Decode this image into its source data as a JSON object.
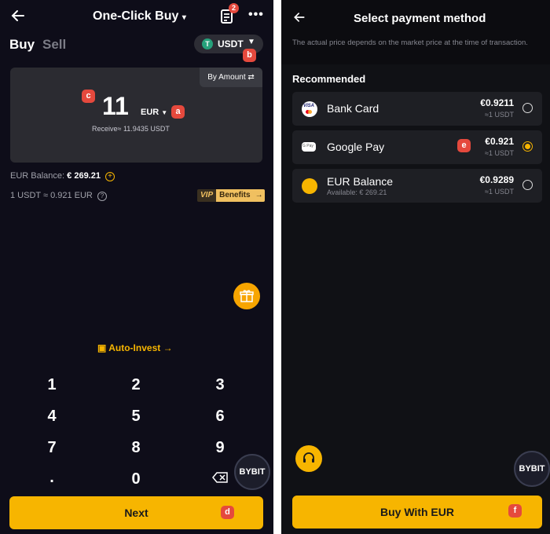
{
  "left": {
    "header": {
      "title": "One-Click Buy",
      "notif_count": "2"
    },
    "tabs": {
      "buy": "Buy",
      "sell": "Sell"
    },
    "coin": {
      "label": "USDT",
      "icon_glyph": "T"
    },
    "amount_card": {
      "by_amount": "By Amount",
      "amount": "11",
      "currency": "EUR",
      "receive": "Receive≈ 11.9435 USDT"
    },
    "balance": {
      "label": "EUR Balance:",
      "value": "€ 269.21"
    },
    "rate": {
      "text": "1 USDT ≈ 0.921 EUR"
    },
    "vip": {
      "tag": "VIP",
      "label": "Benefits"
    },
    "auto_invest": "Auto-Invest",
    "keypad": [
      "1",
      "2",
      "3",
      "4",
      "5",
      "6",
      "7",
      "8",
      "9",
      ".",
      "0"
    ],
    "next_label": "Next",
    "bybit": "BYBIT"
  },
  "right": {
    "header": {
      "title": "Select payment method"
    },
    "notice": "The actual price depends on the market price at the time of transaction.",
    "section": "Recommended",
    "methods": [
      {
        "name": "Bank Card",
        "sub": "",
        "price": "€0.9211",
        "approx": "≈1 USDT",
        "selected": false
      },
      {
        "name": "Google Pay",
        "sub": "",
        "price": "€0.921",
        "approx": "≈1 USDT",
        "selected": true
      },
      {
        "name": "EUR Balance",
        "sub": "Available: € 269.21",
        "price": "€0.9289",
        "approx": "≈1 USDT",
        "selected": false
      }
    ],
    "icon_labels": {
      "visa": "VISA",
      "gpay": "G Pay"
    },
    "buy_label": "Buy With EUR",
    "bybit": "BYBIT"
  },
  "annotations": {
    "a": "a",
    "b": "b",
    "c": "c",
    "d": "d",
    "e": "e",
    "f": "f"
  },
  "colors": {
    "accent": "#f7b500",
    "badge": "#e5493d",
    "bg": "#0e0d19",
    "card": "#2b2b31"
  }
}
